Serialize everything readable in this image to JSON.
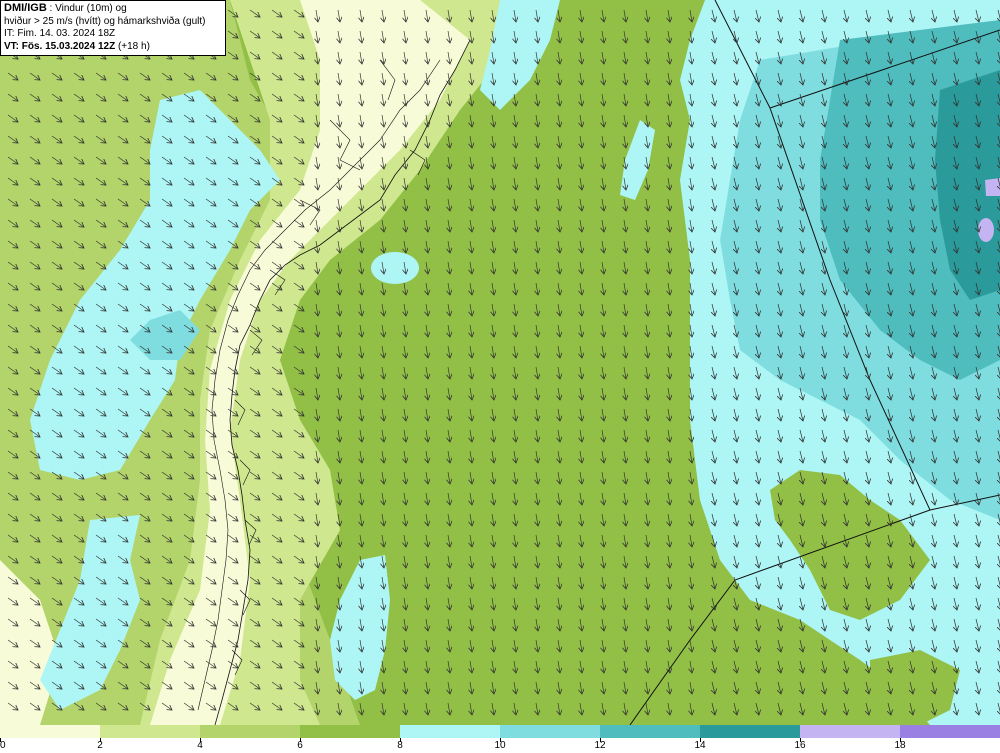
{
  "header": {
    "source": "DMI/IGB",
    "line1_rest": " : Vindur (10m) og",
    "line2": "hviður > 25 m/s (hvítt) og hámarkshviða (gult)",
    "line3": "IT: Fim. 14. 03. 2024 18Z",
    "line4_bold": "VT: Fös. 15.03.2024 12Z",
    "line4_rest": " (+18 h)"
  },
  "legend": {
    "ticks": [
      "0",
      "2",
      "4",
      "6",
      "8",
      "10",
      "12",
      "14",
      "16",
      "18"
    ],
    "colors": [
      "#f8fbd8",
      "#cfe78e",
      "#b2d46a",
      "#92c046",
      "#aef6f6",
      "#7fdde0",
      "#4fbcbd",
      "#2a9a9a",
      "#c4b4f2",
      "#9a80e2"
    ]
  },
  "map_colors": {
    "land_low": "#f8fbd8",
    "wind_2_4": "#cfe78e",
    "wind_4_6": "#b2d46a",
    "wind_6_8": "#92c046",
    "wind_8_10": "#aef6f6",
    "wind_10_12": "#7fdde0",
    "wind_12_14": "#4fbcbd",
    "wind_14_16": "#2a9a9a",
    "wind_16_18": "#c4b4f2"
  }
}
